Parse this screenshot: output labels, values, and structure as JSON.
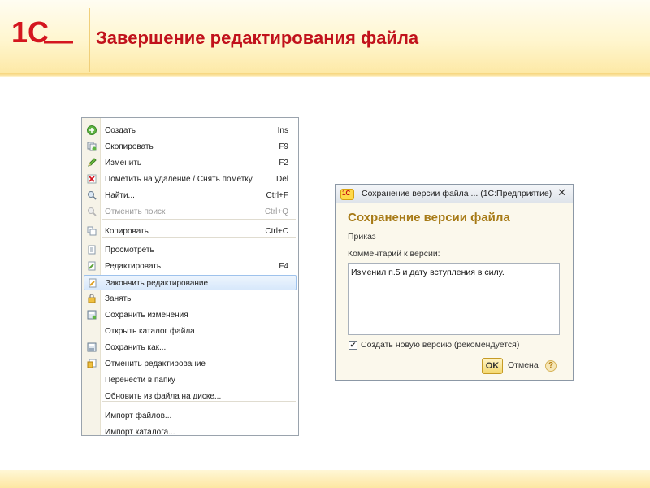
{
  "slide": {
    "title": "Завершение редактирования файла",
    "logo_text": "1С"
  },
  "context_menu": {
    "items": [
      {
        "label": "Создать",
        "shortcut": "Ins",
        "icon": "add-icon",
        "state": "normal"
      },
      {
        "label": "Скопировать",
        "shortcut": "F9",
        "icon": "copy-item-icon",
        "state": "normal"
      },
      {
        "label": "Изменить",
        "shortcut": "F2",
        "icon": "pencil-icon",
        "state": "normal"
      },
      {
        "label": "Пометить на удаление / Снять пометку",
        "shortcut": "Del",
        "icon": "delete-mark-icon",
        "state": "normal"
      },
      {
        "label": "Найти...",
        "shortcut": "Ctrl+F",
        "icon": "search-icon",
        "state": "normal"
      },
      {
        "label": "Отменить поиск",
        "shortcut": "Ctrl+Q",
        "icon": "cancel-search-icon",
        "state": "disabled"
      },
      {
        "label": "Копировать",
        "shortcut": "Ctrl+C",
        "icon": "copy-icon",
        "state": "normal"
      },
      {
        "label": "Просмотреть",
        "shortcut": "",
        "icon": "view-icon",
        "state": "normal"
      },
      {
        "label": "Редактировать",
        "shortcut": "F4",
        "icon": "edit-file-icon",
        "state": "normal"
      },
      {
        "label": "Закончить редактирование",
        "shortcut": "",
        "icon": "finish-edit-icon",
        "state": "selected"
      },
      {
        "label": "Занять",
        "shortcut": "",
        "icon": "lock-icon",
        "state": "normal"
      },
      {
        "label": "Сохранить изменения",
        "shortcut": "",
        "icon": "save-changes-icon",
        "state": "normal"
      },
      {
        "label": "Открыть каталог файла",
        "shortcut": "",
        "icon": "",
        "state": "normal"
      },
      {
        "label": "Сохранить как...",
        "shortcut": "",
        "icon": "save-as-icon",
        "state": "normal"
      },
      {
        "label": "Отменить редактирование",
        "shortcut": "",
        "icon": "cancel-edit-icon",
        "state": "normal"
      },
      {
        "label": "Перенести в папку",
        "shortcut": "",
        "icon": "",
        "state": "normal"
      },
      {
        "label": "Обновить из файла на диске...",
        "shortcut": "",
        "icon": "",
        "state": "normal"
      },
      {
        "label": "Импорт файлов...",
        "shortcut": "",
        "icon": "",
        "state": "normal"
      },
      {
        "label": "Импорт каталога...",
        "shortcut": "",
        "icon": "",
        "state": "normal"
      }
    ]
  },
  "dialog": {
    "window_title": "Сохранение версии файла ... (1С:Предприятие)",
    "logo_text": "1С",
    "close_glyph": "✕",
    "heading": "Сохранение версии файла",
    "file_name": "Приказ",
    "comment_label": "Комментарий к версии:",
    "comment_value": "Изменил п.5 и дату вступления в силу.",
    "create_new_version_label": "Создать новую версию (рекомендуется)",
    "create_new_version_checked": true,
    "check_glyph": "✔",
    "ok_label": "OK",
    "cancel_label": "Отмена",
    "help_label": "?"
  },
  "colors": {
    "title": "#c1121c",
    "dialog_heading": "#a77a16",
    "selection": "#d7e8fb",
    "header_gradient_end": "#fde9a6"
  }
}
